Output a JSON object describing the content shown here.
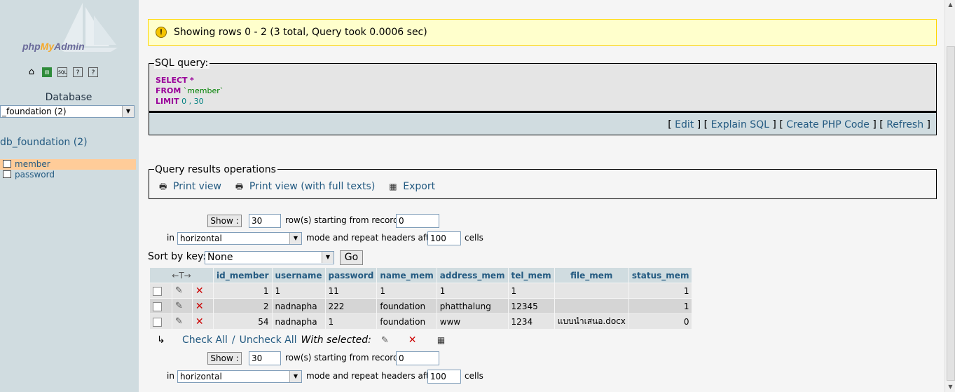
{
  "nav": {
    "logo_prefix": "php",
    "logo_my": "My",
    "logo_suffix": "Admin",
    "icons": [
      "home-icon",
      "exit-icon",
      "sql-icon",
      "docs-icon",
      "sql-docs-icon"
    ],
    "database_label": "Database",
    "database_select": "_foundation (2)",
    "db_name": "db_foundation (2)",
    "tables": [
      {
        "label": "member",
        "active": true
      },
      {
        "label": "password",
        "active": false
      }
    ]
  },
  "notice": {
    "text": "Showing rows 0 - 2 (3 total, Query took 0.0006 sec)"
  },
  "sql": {
    "legend": "SQL query:",
    "line1_kw": "SELECT",
    "line1_rest": "*",
    "line2_kw": "FROM",
    "line2_rest": "`member`",
    "line3_kw": "LIMIT",
    "line3_rest": "0 , 30",
    "links": [
      "Edit",
      "Explain SQL",
      "Create PHP Code",
      "Refresh"
    ]
  },
  "qro": {
    "legend": "Query results operations",
    "print_view": "Print view",
    "print_full": "Print view (with full texts)",
    "export": "Export"
  },
  "nav_top": {
    "show_button": "Show :",
    "rows_value": "30",
    "rows_label": "row(s) starting from record #",
    "start_value": "0",
    "in_label": "in",
    "mode_value": "horizontal",
    "mode_label": "mode and repeat headers after",
    "repeat_value": "100",
    "cells_label": "cells"
  },
  "sort": {
    "label": "Sort by key:",
    "value": "None",
    "go": "Go"
  },
  "table": {
    "sort_arrows": "←T→",
    "columns": [
      "id_member",
      "username",
      "password",
      "name_mem",
      "address_mem",
      "tel_mem",
      "file_mem",
      "status_mem"
    ],
    "rows": [
      [
        "1",
        "1",
        "11",
        "1",
        "1",
        "1",
        "",
        "1"
      ],
      [
        "2",
        "nadnapha",
        "222",
        "foundation",
        "phatthalung",
        "12345",
        "",
        "1"
      ],
      [
        "54",
        "nadnapha",
        "1",
        "foundation",
        "www",
        "1234",
        "แบบนำเสนอ.docx",
        "0"
      ]
    ]
  },
  "footer": {
    "check_all": "Check All",
    "separator": "/",
    "uncheck_all": "Uncheck All",
    "with_selected": "With selected:"
  },
  "nav_bottom": {
    "show_button": "Show :",
    "rows_value": "30",
    "rows_label": "row(s) starting from record #",
    "start_value": "0",
    "in_label": "in",
    "mode_value": "horizontal",
    "mode_label": "mode and repeat headers after",
    "repeat_value": "100",
    "cells_label": "cells"
  }
}
